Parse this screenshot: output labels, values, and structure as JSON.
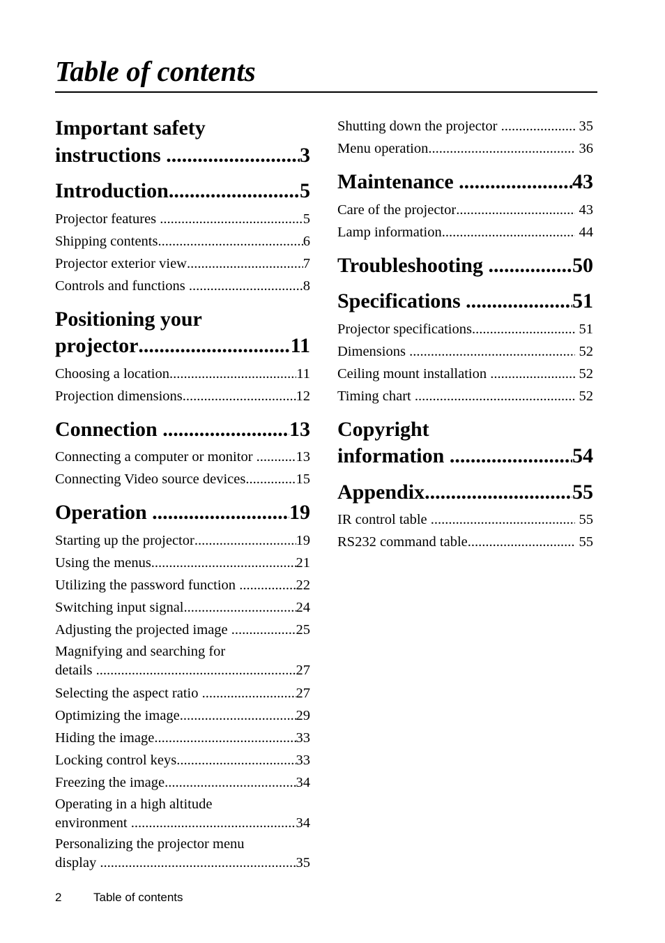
{
  "title": "Table of contents",
  "footer": {
    "page_number": "2",
    "section": "Table of contents"
  },
  "left": [
    {
      "type": "chapter",
      "lead": "Important safety",
      "label": "instructions ",
      "page": "3"
    },
    {
      "type": "chapter",
      "label": "Introduction",
      "page": "5"
    },
    {
      "type": "sub",
      "label": "Projector features ",
      "page": "5"
    },
    {
      "type": "sub",
      "label": "Shipping contents",
      "page": "6"
    },
    {
      "type": "sub",
      "label": "Projector exterior view",
      "page": "7"
    },
    {
      "type": "sub",
      "label": "Controls and functions ",
      "page": "8"
    },
    {
      "type": "chapter",
      "lead": "Positioning your",
      "label": "projector",
      "page": "11"
    },
    {
      "type": "sub",
      "label": "Choosing a location",
      "page": "11"
    },
    {
      "type": "sub",
      "label": "Projection dimensions",
      "page": "12"
    },
    {
      "type": "chapter",
      "label": "Connection ",
      "page": "13"
    },
    {
      "type": "sub",
      "label": "Connecting a computer or monitor ",
      "page": "13"
    },
    {
      "type": "sub",
      "label": "Connecting Video source devices",
      "page": "15"
    },
    {
      "type": "chapter",
      "label": "Operation ",
      "page": "19"
    },
    {
      "type": "sub",
      "label": "Starting up the projector",
      "page": "19"
    },
    {
      "type": "sub",
      "label": "Using the menus",
      "page": "21"
    },
    {
      "type": "sub",
      "label": "Utilizing the password function ",
      "page": "22"
    },
    {
      "type": "sub",
      "label": "Switching input signal",
      "page": "24"
    },
    {
      "type": "sub",
      "label": "Adjusting the projected image ",
      "page": "25"
    },
    {
      "type": "sub-wrap",
      "lead": "Magnifying and searching for",
      "label": "details ",
      "page": "27"
    },
    {
      "type": "sub",
      "label": "Selecting the aspect ratio ",
      "page": "27"
    },
    {
      "type": "sub",
      "label": "Optimizing the image",
      "page": "29"
    },
    {
      "type": "sub",
      "label": "Hiding the image",
      "page": "33"
    },
    {
      "type": "sub",
      "label": "Locking control keys",
      "page": "33"
    },
    {
      "type": "sub",
      "label": "Freezing the image",
      "page": "34"
    },
    {
      "type": "sub-wrap",
      "lead": "Operating in a high altitude",
      "label": "environment ",
      "page": "34"
    },
    {
      "type": "sub-wrap",
      "lead": "Personalizing the projector menu",
      "label": "display ",
      "page": "35"
    }
  ],
  "right": [
    {
      "type": "sub",
      "label": "Shutting down the projector ",
      "page": " 35"
    },
    {
      "type": "sub",
      "label": "Menu operation",
      "page": " 36"
    },
    {
      "type": "chapter",
      "label": "Maintenance ",
      "page": "43"
    },
    {
      "type": "sub",
      "label": "Care of the projector",
      "page": " 43"
    },
    {
      "type": "sub",
      "label": "Lamp information",
      "page": " 44"
    },
    {
      "type": "chapter",
      "label": "Troubleshooting ",
      "page": "50"
    },
    {
      "type": "chapter",
      "label": "Specifications ",
      "page": "51"
    },
    {
      "type": "sub",
      "label": "Projector specifications",
      "page": " 51"
    },
    {
      "type": "sub",
      "label": "Dimensions ",
      "page": " 52"
    },
    {
      "type": "sub",
      "label": "Ceiling mount installation ",
      "page": " 52"
    },
    {
      "type": "sub",
      "label": "Timing chart ",
      "page": " 52"
    },
    {
      "type": "chapter",
      "lead": "Copyright",
      "label": "information ",
      "page": "54"
    },
    {
      "type": "chapter",
      "label": "Appendix",
      "page": "55"
    },
    {
      "type": "sub",
      "label": "IR control table ",
      "page": " 55"
    },
    {
      "type": "sub",
      "label": "RS232 command table",
      "page": " 55"
    }
  ]
}
